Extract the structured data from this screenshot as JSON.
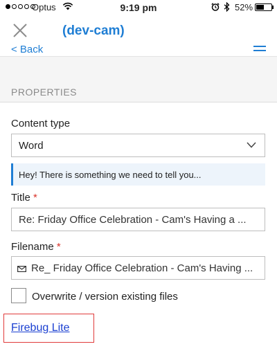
{
  "status_bar": {
    "carrier": "Optus",
    "time": "9:19 pm",
    "battery_percent": "52%",
    "battery_level": 0.52,
    "signal_bars_filled": 1,
    "signal_bars_total": 5
  },
  "header": {
    "title": "(dev-cam)",
    "close_icon": "close-icon"
  },
  "nav": {
    "back_label": "< Back",
    "menu_icon": "hamburger-menu-icon"
  },
  "section": {
    "heading": "PROPERTIES"
  },
  "form": {
    "content_type": {
      "label": "Content type",
      "selected": "Word"
    },
    "notice": "Hey! There is something we need to tell you...",
    "title": {
      "label": "Title",
      "required_mark": "*",
      "value": "Re: Friday Office Celebration - Cam's Having a ..."
    },
    "filename": {
      "label": "Filename",
      "required_mark": "*",
      "value": "Re_ Friday Office Celebration - Cam's Having ..."
    },
    "overwrite": {
      "label": "Overwrite / version existing files",
      "checked": false
    }
  },
  "footer": {
    "firebug_link": "Firebug Lite"
  },
  "colors": {
    "accent": "#1f7ed4",
    "required": "#d9342b",
    "link": "#1a3fd1",
    "highlight_border": "#e03a3a"
  }
}
